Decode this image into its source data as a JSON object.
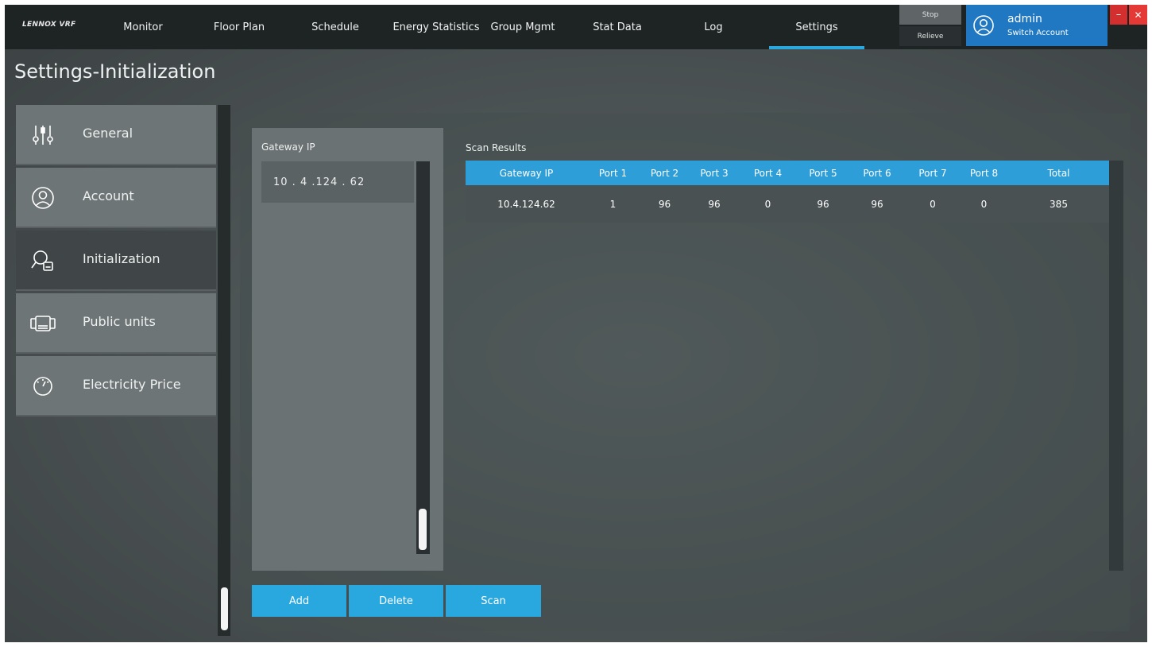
{
  "app": {
    "logo": "LENNOX VRF",
    "page_title": "Settings-Initialization"
  },
  "nav": {
    "items": [
      {
        "label": "Monitor"
      },
      {
        "label": "Floor Plan"
      },
      {
        "label": "Schedule"
      },
      {
        "label": "Energy Statistics"
      },
      {
        "label": "Group Mgmt"
      },
      {
        "label": "Stat Data"
      },
      {
        "label": "Log"
      },
      {
        "label": "Settings",
        "active": true
      }
    ],
    "stop_label": "Stop",
    "relieve_label": "Relieve",
    "user": "admin",
    "switch_account_label": "Switch Account",
    "minimize_glyph": "–",
    "close_glyph": "✕"
  },
  "sidebar": {
    "items": [
      {
        "label": "General",
        "icon": "sliders-icon"
      },
      {
        "label": "Account",
        "icon": "user-icon"
      },
      {
        "label": "Initialization",
        "icon": "search-device-icon",
        "active": true
      },
      {
        "label": "Public units",
        "icon": "public-units-icon"
      },
      {
        "label": "Electricity Price",
        "icon": "gauge-icon"
      }
    ]
  },
  "gateway": {
    "title": "Gateway IP",
    "entries": [
      "10 . 4 .124 . 62"
    ]
  },
  "scan": {
    "title": "Scan Results",
    "columns": [
      "Gateway IP",
      "Port 1",
      "Port 2",
      "Port 3",
      "Port 4",
      "Port 5",
      "Port 6",
      "Port 7",
      "Port 8",
      "Total"
    ],
    "rows": [
      [
        "10.4.124.62",
        "1",
        "96",
        "96",
        "0",
        "96",
        "96",
        "0",
        "0",
        "385"
      ]
    ]
  },
  "actions": {
    "add_label": "Add",
    "delete_label": "Delete",
    "scan_label": "Scan"
  },
  "colors": {
    "accent": "#29a8df",
    "account_bg": "#1f78c1",
    "close_red": "#e53935",
    "active_side": "#404647"
  }
}
